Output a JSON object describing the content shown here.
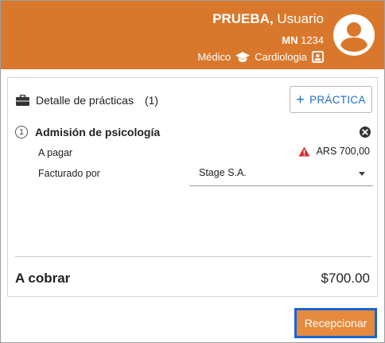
{
  "colors": {
    "header_bg": "#d9782c",
    "primary_text": "#212121",
    "accent_blue": "#1e6fbf",
    "warning_red": "#d32f2f",
    "submit_bg": "#e68a3e",
    "focus_border": "#1565d8"
  },
  "header": {
    "last_name": "PRUEBA,",
    "first_name": "Usuario",
    "mn_label": "MN",
    "mn_number": "1234",
    "role": "Médico",
    "role_icon": "graduation-cap-icon",
    "specialty": "Cardiologia",
    "specialty_icon": "badge-icon",
    "avatar_icon": "account-circle-icon"
  },
  "practices": {
    "title": "Detalle de prácticas",
    "title_icon": "briefcase-icon",
    "count": "(1)",
    "add_button_label": "PRÁCTICA",
    "add_button_icon": "plus-icon",
    "items": [
      {
        "number": "1",
        "name": "Admisión de psicología",
        "pay_label": "A pagar",
        "pay_value": "ARS 700,00",
        "pay_icon": "warning-icon",
        "billed_by_label": "Facturado por",
        "billed_by_value": "Stage S.A.",
        "remove_icon": "close-circle-icon"
      }
    ]
  },
  "summary": {
    "label": "A cobrar",
    "value": "$700.00"
  },
  "actions": {
    "submit_label": "Recepcionar"
  }
}
